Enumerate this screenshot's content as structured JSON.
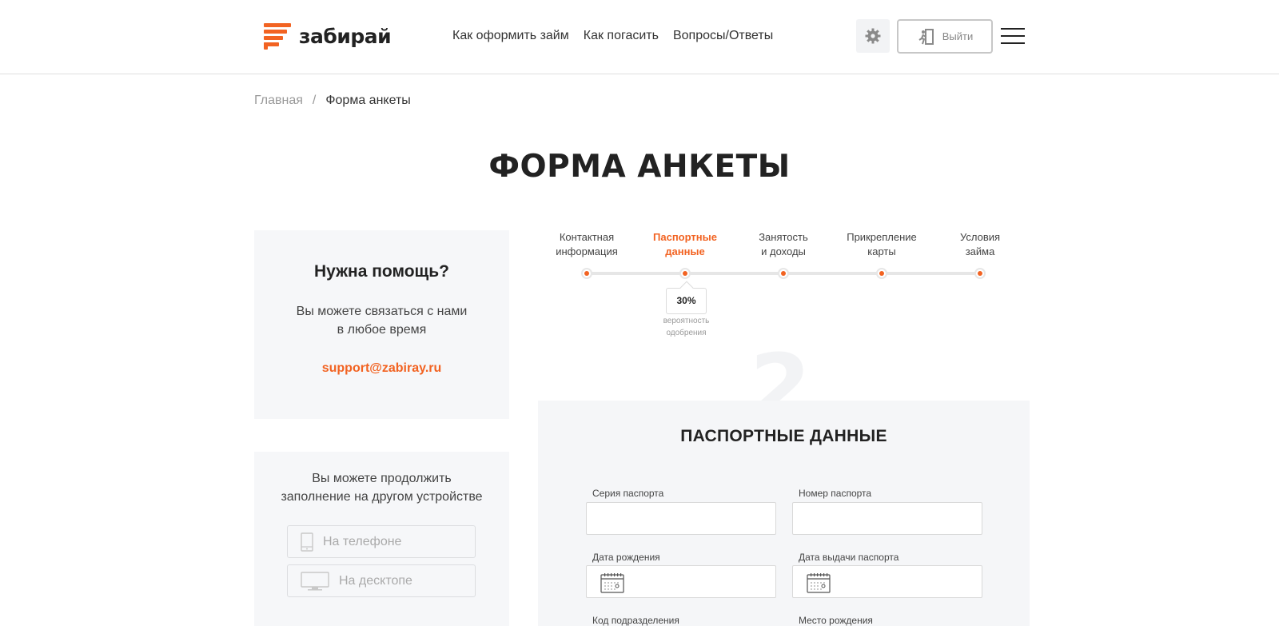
{
  "header": {
    "logo_text": "забирай",
    "nav": [
      "Как оформить займ",
      "Как погасить",
      "Вопросы/Ответы"
    ],
    "logout_label": "Выйти"
  },
  "breadcrumb": {
    "home": "Главная",
    "separator": "/",
    "current": "Форма анкеты"
  },
  "page_title": "ФОРМА АНКЕТЫ",
  "help": {
    "title": "Нужна помощь?",
    "text_line1": "Вы можете связаться с нами",
    "text_line2": "в любое время",
    "email": "support@zabiray.ru"
  },
  "device": {
    "text_line1": "Вы можете продолжить",
    "text_line2": "заполнение на другом устройстве",
    "phone_label": "На телефоне",
    "desktop_label": "На десктопе"
  },
  "steps": [
    {
      "line1": "Контактная",
      "line2": "информация",
      "active": false
    },
    {
      "line1": "Паспортные",
      "line2": "данные",
      "active": true
    },
    {
      "line1": "Занятость",
      "line2": "и доходы",
      "active": false
    },
    {
      "line1": "Прикрепление",
      "line2": "карты",
      "active": false
    },
    {
      "line1": "Условия",
      "line2": "займа",
      "active": false
    }
  ],
  "approval": {
    "value": "30%",
    "label_line1": "вероятность",
    "label_line2": "одобрения"
  },
  "step_number": "2",
  "form": {
    "title": "ПАСПОРТНЫЕ ДАННЫЕ",
    "fields": {
      "series": {
        "label": "Серия паспорта",
        "value": ""
      },
      "number": {
        "label": "Номер паспорта",
        "value": ""
      },
      "birth_date": {
        "label": "Дата рождения",
        "value": ""
      },
      "issue_date": {
        "label": "Дата выдачи паспорта",
        "value": ""
      },
      "division_code": {
        "label": "Код подразделения",
        "value": ""
      },
      "birth_place": {
        "label": "Место рождения",
        "value": ""
      }
    }
  },
  "colors": {
    "accent": "#f26322",
    "card_bg": "#f5f6f8",
    "text": "#222222"
  },
  "icons": [
    "logo-mark-icon",
    "gear-icon",
    "logout-door-icon",
    "menu-icon",
    "phone-icon",
    "desktop-icon",
    "calendar-icon"
  ]
}
